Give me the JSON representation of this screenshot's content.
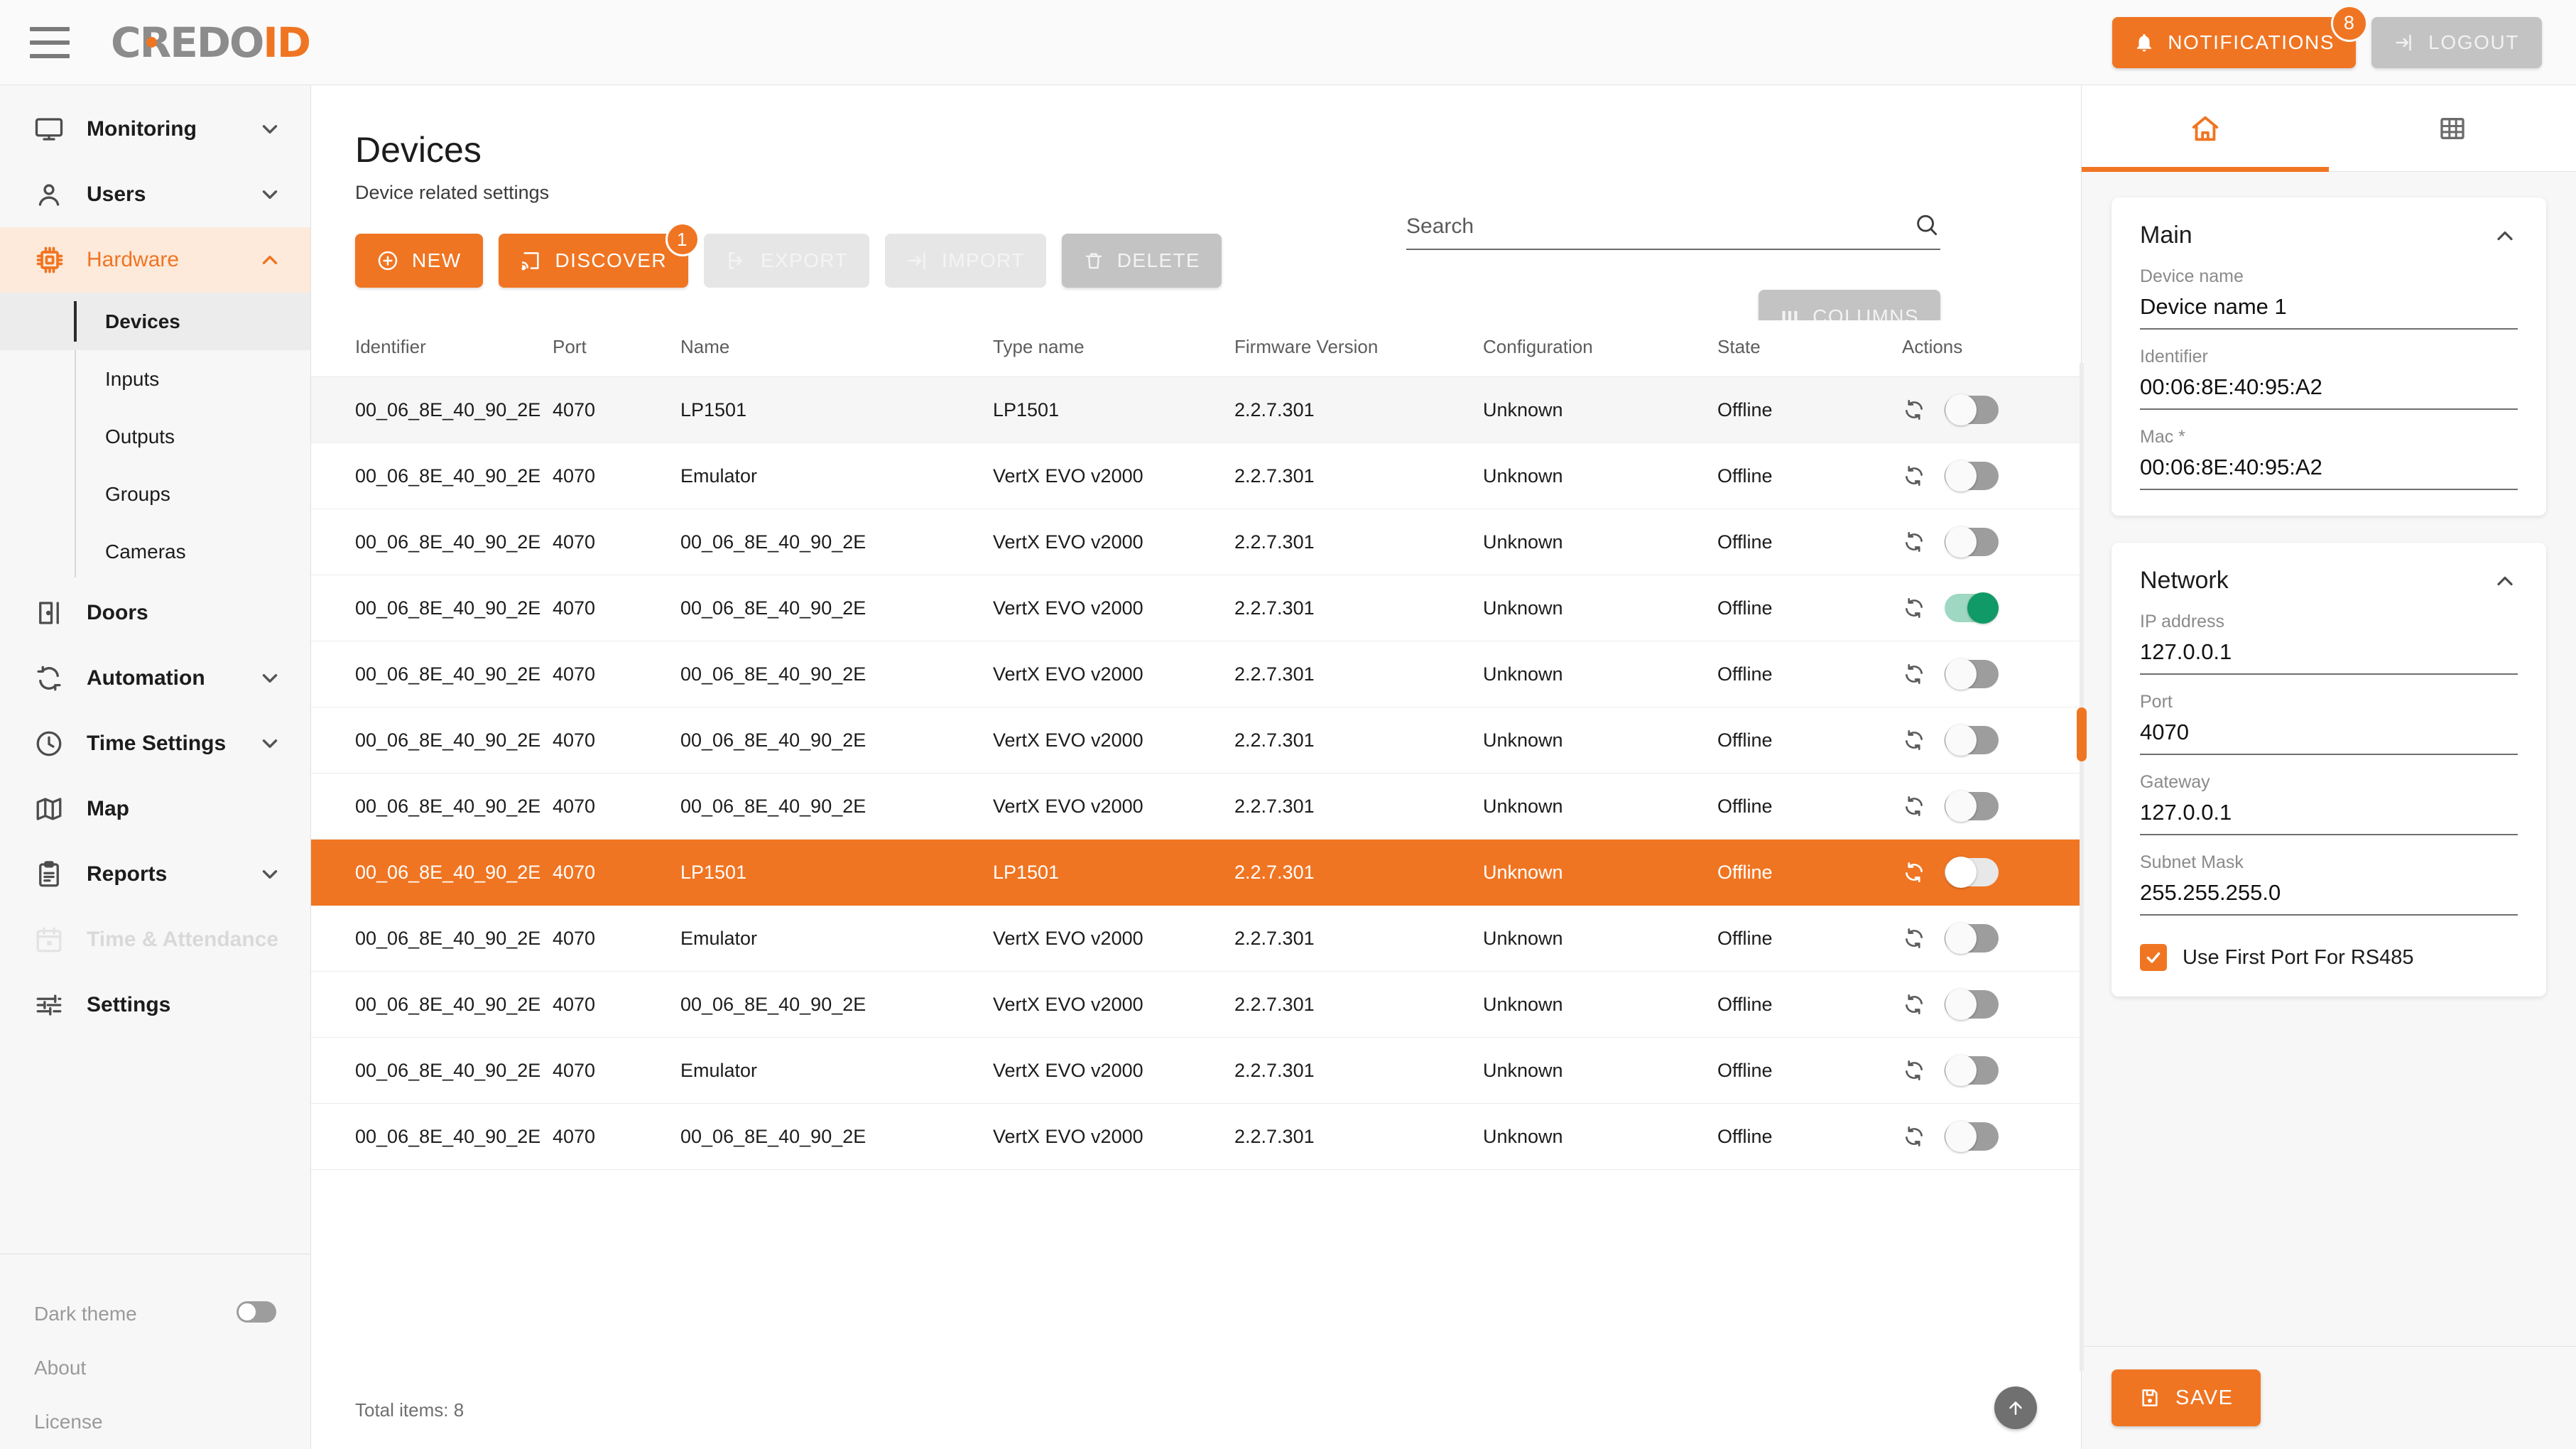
{
  "topbar": {
    "menu_icon": "hamburger-icon",
    "logo_primary": "CREDO",
    "logo_accent": "ID",
    "notifications_label": "NOTIFICATIONS",
    "notifications_count": "8",
    "logout_label": "LOGOUT",
    "accent_color": "#f07522",
    "logo_gray": "#8c8c8c"
  },
  "sidebar": {
    "items": [
      {
        "label": "Monitoring",
        "icon": "monitor-icon",
        "expandable": true,
        "expanded": false
      },
      {
        "label": "Users",
        "icon": "user-icon",
        "expandable": true,
        "expanded": false
      },
      {
        "label": "Hardware",
        "icon": "chip-icon",
        "expandable": true,
        "expanded": true,
        "active": true
      },
      {
        "label": "Doors",
        "icon": "door-icon",
        "expandable": false
      },
      {
        "label": "Automation",
        "icon": "sync-icon",
        "expandable": true,
        "expanded": false
      },
      {
        "label": "Time Settings",
        "icon": "clock-icon",
        "expandable": true,
        "expanded": false
      },
      {
        "label": "Map",
        "icon": "map-icon",
        "expandable": false
      },
      {
        "label": "Reports",
        "icon": "clipboard-icon",
        "expandable": true,
        "expanded": false
      },
      {
        "label": "Time & Attendance",
        "icon": "calendar-icon",
        "expandable": false,
        "disabled": true
      },
      {
        "label": "Settings",
        "icon": "sliders-icon",
        "expandable": false
      }
    ],
    "hardware_children": [
      {
        "label": "Devices",
        "selected": true
      },
      {
        "label": "Inputs",
        "selected": false
      },
      {
        "label": "Outputs",
        "selected": false
      },
      {
        "label": "Groups",
        "selected": false
      },
      {
        "label": "Cameras",
        "selected": false
      }
    ],
    "footer": {
      "dark_theme_label": "Dark theme",
      "dark_theme_on": false,
      "about_label": "About",
      "license_label": "License"
    }
  },
  "main": {
    "title": "Devices",
    "subtitle": "Device related settings",
    "toolbar": {
      "new_label": "NEW",
      "discover_label": "DISCOVER",
      "discover_badge": "1",
      "export_label": "EXPORT",
      "import_label": "IMPORT",
      "delete_label": "DELETE",
      "columns_label": "COLUMNS"
    },
    "search": {
      "placeholder": "Search",
      "value": ""
    },
    "table": {
      "columns": [
        "Identifier",
        "Port",
        "Name",
        "Type name",
        "Firmware Version",
        "Configuration",
        "State",
        "Actions"
      ],
      "rows": [
        {
          "identifier": "00_06_8E_40_90_2E",
          "port": "4070",
          "name": "LP1501",
          "type_name": "LP1501",
          "firmware": "2.2.7.301",
          "configuration": "Unknown",
          "state": "Offline",
          "enabled": false,
          "zebra": true,
          "selected": false
        },
        {
          "identifier": "00_06_8E_40_90_2E",
          "port": "4070",
          "name": "Emulator",
          "type_name": "VertX EVO v2000",
          "firmware": "2.2.7.301",
          "configuration": "Unknown",
          "state": "Offline",
          "enabled": false,
          "zebra": false,
          "selected": false
        },
        {
          "identifier": "00_06_8E_40_90_2E",
          "port": "4070",
          "name": "00_06_8E_40_90_2E",
          "type_name": "VertX EVO v2000",
          "firmware": "2.2.7.301",
          "configuration": "Unknown",
          "state": "Offline",
          "enabled": false,
          "zebra": false,
          "selected": false
        },
        {
          "identifier": "00_06_8E_40_90_2E",
          "port": "4070",
          "name": "00_06_8E_40_90_2E",
          "type_name": "VertX EVO v2000",
          "firmware": "2.2.7.301",
          "configuration": "Unknown",
          "state": "Offline",
          "enabled": true,
          "zebra": false,
          "selected": false
        },
        {
          "identifier": "00_06_8E_40_90_2E",
          "port": "4070",
          "name": "00_06_8E_40_90_2E",
          "type_name": "VertX EVO v2000",
          "firmware": "2.2.7.301",
          "configuration": "Unknown",
          "state": "Offline",
          "enabled": false,
          "zebra": false,
          "selected": false
        },
        {
          "identifier": "00_06_8E_40_90_2E",
          "port": "4070",
          "name": "00_06_8E_40_90_2E",
          "type_name": "VertX EVO v2000",
          "firmware": "2.2.7.301",
          "configuration": "Unknown",
          "state": "Offline",
          "enabled": false,
          "zebra": false,
          "selected": false
        },
        {
          "identifier": "00_06_8E_40_90_2E",
          "port": "4070",
          "name": "00_06_8E_40_90_2E",
          "type_name": "VertX EVO v2000",
          "firmware": "2.2.7.301",
          "configuration": "Unknown",
          "state": "Offline",
          "enabled": false,
          "zebra": false,
          "selected": false
        },
        {
          "identifier": "00_06_8E_40_90_2E",
          "port": "4070",
          "name": "LP1501",
          "type_name": "LP1501",
          "firmware": "2.2.7.301",
          "configuration": "Unknown",
          "state": "Offline",
          "enabled": false,
          "zebra": false,
          "selected": true
        },
        {
          "identifier": "00_06_8E_40_90_2E",
          "port": "4070",
          "name": "Emulator",
          "type_name": "VertX EVO v2000",
          "firmware": "2.2.7.301",
          "configuration": "Unknown",
          "state": "Offline",
          "enabled": false,
          "zebra": false,
          "selected": false
        },
        {
          "identifier": "00_06_8E_40_90_2E",
          "port": "4070",
          "name": "00_06_8E_40_90_2E",
          "type_name": "VertX EVO v2000",
          "firmware": "2.2.7.301",
          "configuration": "Unknown",
          "state": "Offline",
          "enabled": false,
          "zebra": false,
          "selected": false
        },
        {
          "identifier": "00_06_8E_40_90_2E",
          "port": "4070",
          "name": "Emulator",
          "type_name": "VertX EVO v2000",
          "firmware": "2.2.7.301",
          "configuration": "Unknown",
          "state": "Offline",
          "enabled": false,
          "zebra": false,
          "selected": false
        },
        {
          "identifier": "00_06_8E_40_90_2E",
          "port": "4070",
          "name": "00_06_8E_40_90_2E",
          "type_name": "VertX EVO v2000",
          "firmware": "2.2.7.301",
          "configuration": "Unknown",
          "state": "Offline",
          "enabled": false,
          "zebra": false,
          "selected": false
        }
      ]
    },
    "footer": {
      "total_items": "Total items: 8",
      "scroll_top_icon": "arrow-up-icon"
    }
  },
  "rightpanel": {
    "tabs": [
      {
        "icon": "home-icon",
        "active": true
      },
      {
        "icon": "grid-icon",
        "active": false
      }
    ],
    "main_card": {
      "title": "Main",
      "collapse_icon": "chevron-up-icon",
      "fields": [
        {
          "label": "Device name",
          "value": "Device name 1"
        },
        {
          "label": "Identifier",
          "value": "00:06:8E:40:95:A2"
        },
        {
          "label": "Mac *",
          "value": "00:06:8E:40:95:A2"
        }
      ]
    },
    "network_card": {
      "title": "Network",
      "collapse_icon": "chevron-up-icon",
      "fields": [
        {
          "label": "IP address",
          "value": "127.0.0.1"
        },
        {
          "label": "Port",
          "value": "4070"
        },
        {
          "label": "Gateway",
          "value": "127.0.0.1"
        },
        {
          "label": "Subnet Mask",
          "value": "255.255.255.0"
        }
      ],
      "checkbox": {
        "label": "Use First Port For RS485",
        "checked": true
      }
    },
    "save_label": "SAVE"
  }
}
